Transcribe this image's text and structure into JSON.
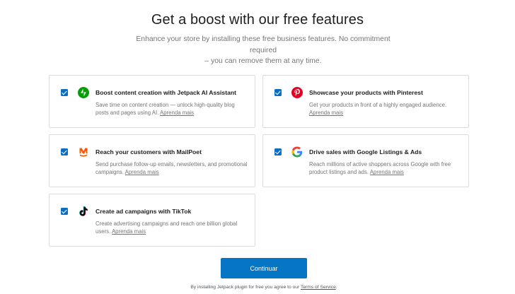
{
  "header": {
    "title": "Get a boost with our free features",
    "subtitle_line1": "Enhance your store by installing these free business features. No commitment required",
    "subtitle_line2": "– you can remove them at any time."
  },
  "features": [
    {
      "title": "Boost content creation with Jetpack AI Assistant",
      "description": "Save time on content creation — unlock high-quality blog posts and pages using AI.",
      "link": "Aprenda mais",
      "checked": true,
      "icon": "jetpack-icon",
      "icon_color": "#069e08"
    },
    {
      "title": "Showcase your products with Pinterest",
      "description": "Get your products in front of a highly engaged audience.",
      "link": "Aprenda mais",
      "checked": true,
      "icon": "pinterest-icon",
      "icon_color": "#e60023"
    },
    {
      "title": "Reach your customers with MailPoet",
      "description": "Send purchase follow-up emails, newsletters, and promotional campaigns.",
      "link": "Aprenda mais",
      "checked": true,
      "icon": "mailpoet-icon",
      "icon_color": "#fe5301"
    },
    {
      "title": "Drive sales with Google Listings & Ads",
      "description": "Reach millions of active shoppers across Google with free product listings and ads.",
      "link": "Aprenda mais",
      "checked": true,
      "icon": "google-icon",
      "icon_color": "#4285f4"
    },
    {
      "title": "Create ad campaigns with TikTok",
      "description": "Create advertising campaigns and reach one billion global users.",
      "link": "Aprenda mais",
      "checked": true,
      "icon": "tiktok-icon",
      "icon_color": "#000000"
    }
  ],
  "actions": {
    "continue_label": "Continuar",
    "accent_color": "#0675c4"
  },
  "footer": {
    "text": "By installing Jetpack plugin for free you agree to our",
    "link": "Terms of Service",
    "suffix": "."
  }
}
